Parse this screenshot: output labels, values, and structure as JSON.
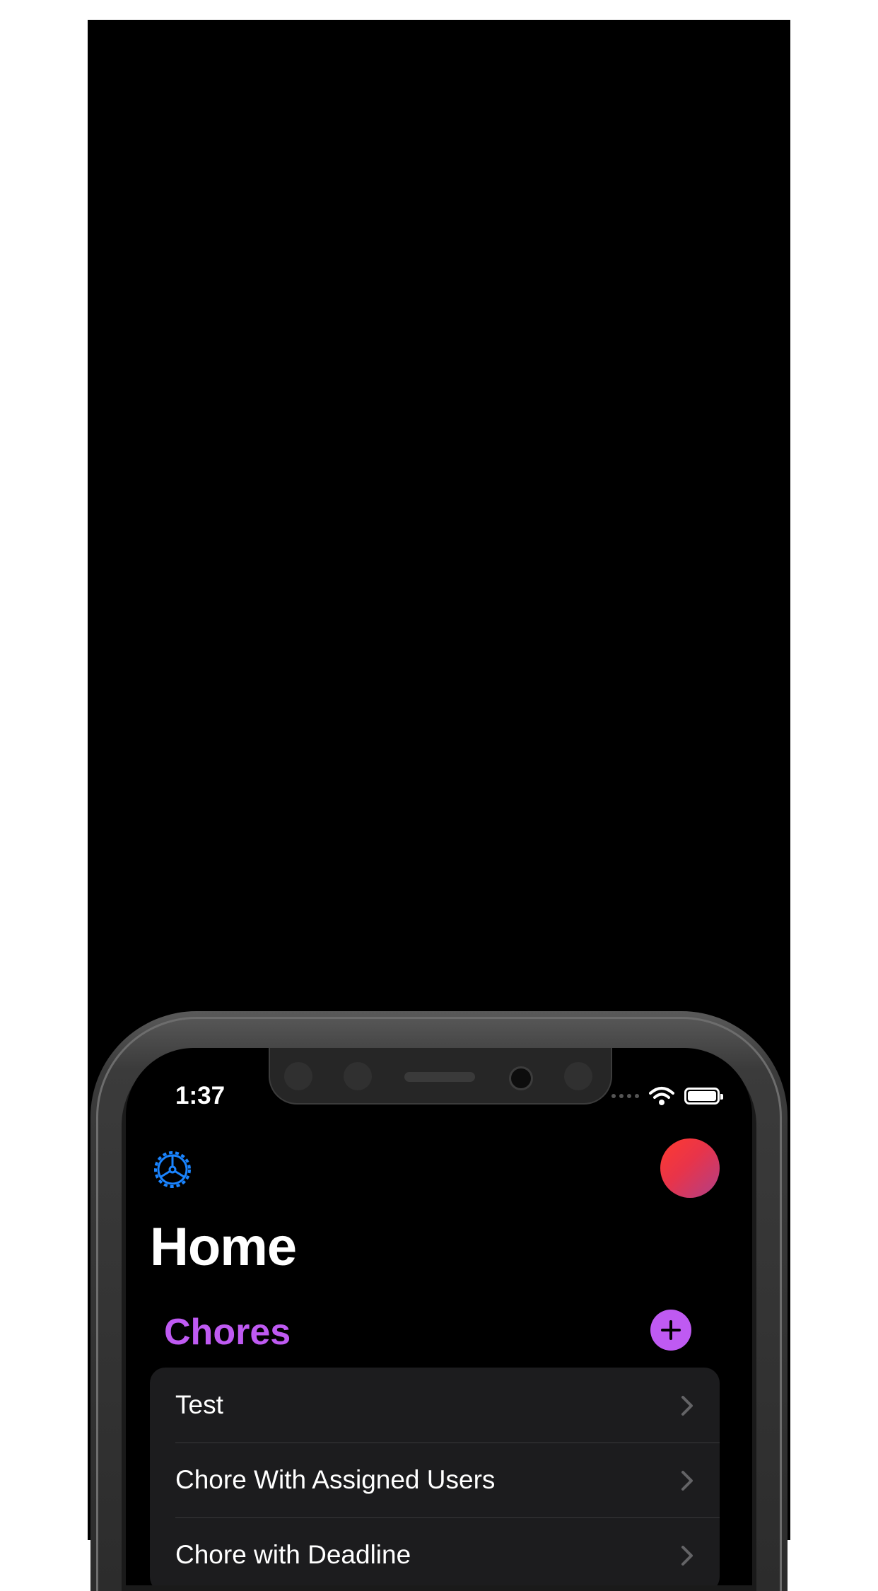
{
  "status_bar": {
    "time": "1:37"
  },
  "header": {
    "title": "Home"
  },
  "chores": {
    "section_title": "Chores",
    "items": [
      {
        "label": "Test"
      },
      {
        "label": "Chore With Assigned Users"
      },
      {
        "label": "Chore with Deadline"
      }
    ]
  },
  "colors": {
    "accent": "#bf5af2",
    "settings_icon": "#1a84ff",
    "background": "#000000",
    "row_background": "#1c1c1e"
  },
  "icons": {
    "settings": "gear-icon",
    "add": "plus-icon",
    "row": "chevron-right-icon",
    "wifi": "wifi-icon",
    "battery": "battery-icon",
    "signal": "signal-icon"
  }
}
